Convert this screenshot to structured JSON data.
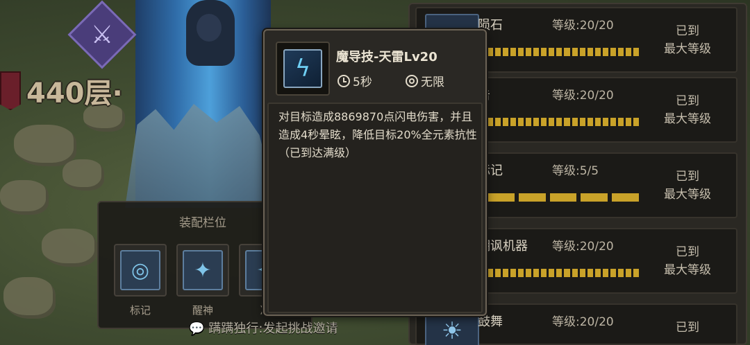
{
  "hud": {
    "floor_label": "440层·"
  },
  "loadout": {
    "title": "装配栏位",
    "slots": [
      {
        "label": "标记",
        "icon": "crosshair-icon"
      },
      {
        "label": "醒神",
        "icon": "sparkle-icon"
      },
      {
        "label": "净",
        "icon": "purify-icon"
      }
    ]
  },
  "invite_text": "蹒蹒独行:发起挑战邀请",
  "skills": [
    {
      "name": "陨石",
      "level": "等级:20/20",
      "progress": 1.0,
      "max_text": [
        "已到",
        "最大等级"
      ],
      "icon": "meteor-icon"
    },
    {
      "name": "击",
      "level": "等级:20/20",
      "progress": 1.0,
      "max_text": [
        "已到",
        "最大等级"
      ],
      "icon": "strike-icon"
    },
    {
      "name": "标记",
      "level": "等级:5/5",
      "progress": 1.0,
      "max_text": [
        "已到",
        "最大等级"
      ],
      "icon": "mark-icon"
    },
    {
      "name": "嘲讽机器",
      "level": "等级:20/20",
      "progress": 1.0,
      "max_text": [
        "已到",
        "最大等级"
      ],
      "icon": "taunt-machine-icon"
    },
    {
      "name": "鼓舞",
      "level": "等级:20/20",
      "progress": 1.0,
      "max_text": [
        "已到"
      ],
      "icon": "inspire-icon"
    }
  ],
  "tooltip": {
    "title": "魔导技-天雷Lv20",
    "cooldown": "5秒",
    "uses": "无限",
    "description": "对目标造成8869870点闪电伤害，并且造成4秒晕眩，降低目标20%全元素抗性（已到达满级）",
    "icon": "lightning-icon"
  },
  "colors": {
    "progress_fill": "#c9a229",
    "panel_bg": "#1b1a17",
    "tooltip_border": "#6c6356"
  }
}
